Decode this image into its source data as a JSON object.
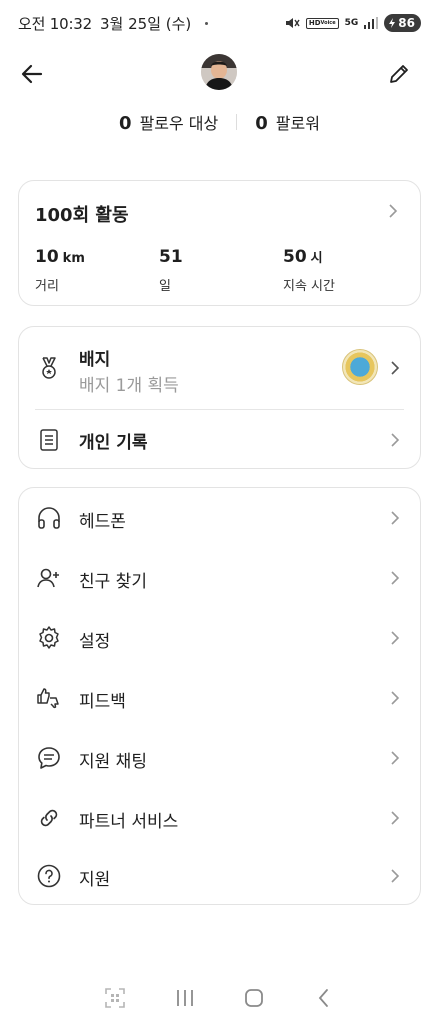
{
  "status_bar": {
    "time": "오전 10:32",
    "date": "3월 25일 (수)",
    "hd_label": "HD",
    "voice_label": "Voice",
    "network": "5G",
    "battery": "86"
  },
  "profile": {
    "following_count": "0",
    "following_label": "팔로우 대상",
    "followers_count": "0",
    "followers_label": "팔로워"
  },
  "activity": {
    "title": "100회 활동",
    "stats": [
      {
        "value": "10",
        "unit": "km",
        "label": "거리"
      },
      {
        "value": "51",
        "unit": "",
        "label": "일"
      },
      {
        "value": "50",
        "unit": "시",
        "label": "지속 시간"
      }
    ]
  },
  "badges": {
    "title": "배지",
    "subtitle": "배지 1개 획득",
    "records_label": "개인 기록"
  },
  "menu": [
    {
      "label": "헤드폰",
      "icon": "headphones-icon"
    },
    {
      "label": "친구 찾기",
      "icon": "add-friend-icon"
    },
    {
      "label": "설정",
      "icon": "gear-icon"
    },
    {
      "label": "피드백",
      "icon": "feedback-thumbs-icon"
    },
    {
      "label": "지원 채팅",
      "icon": "chat-icon"
    },
    {
      "label": "파트너 서비스",
      "icon": "link-icon"
    },
    {
      "label": "지원",
      "icon": "help-icon"
    }
  ]
}
